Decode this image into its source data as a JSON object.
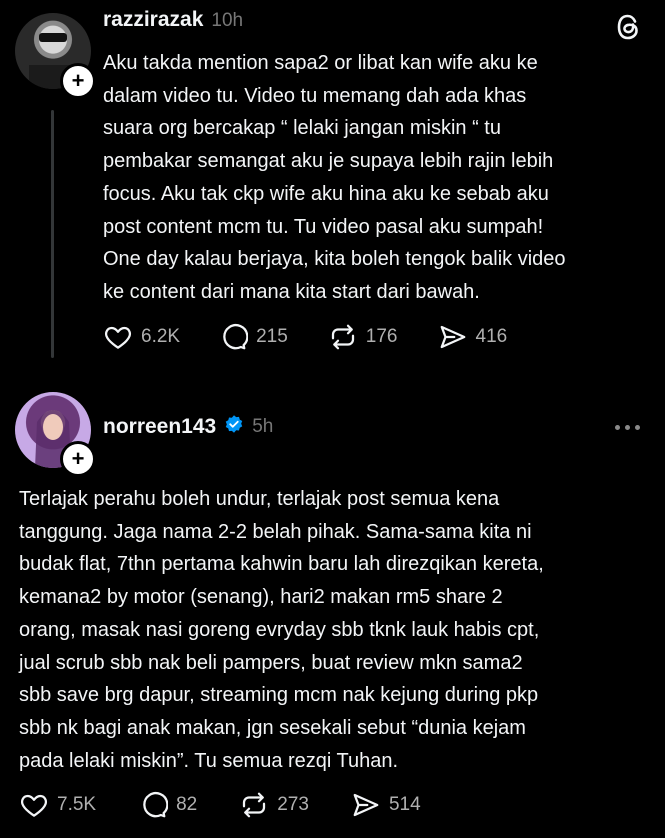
{
  "posts": [
    {
      "username": "razzirazak",
      "time": "10h",
      "verified": false,
      "text": "Aku takda mention sapa2 or libat kan wife aku ke\ndalam video tu. Video tu memang dah ada khas\nsuara org bercakap “ lelaki jangan miskin “ tu\npembakar semangat aku je supaya lebih rajin lebih\nfocus. Aku tak ckp wife aku hina aku ke sebab aku\npost content mcm tu. Tu video pasal aku sumpah!\nOne day kalau berjaya, kita boleh tengok balik video\nke content dari mana kita start dari bawah.",
      "likes": "6.2K",
      "replies": "215",
      "reposts": "176",
      "shares": "416"
    },
    {
      "username": "norreen143",
      "time": "5h",
      "verified": true,
      "text": "Terlajak perahu boleh undur, terlajak post semua kena\ntanggung. Jaga nama 2-2 belah pihak. Sama-sama kita ni\nbudak flat, 7thn pertama kahwin baru lah direzqikan kereta,\nkemana2 by motor (senang), hari2 makan rm5 share 2\norang, masak nasi goreng evryday sbb tknk lauk habis cpt,\njual scrub sbb nak beli pampers, buat review mkn sama2\nsbb save brg dapur, streaming mcm nak kejung during pkp\nsbb nk bagi anak makan, jgn sesekali sebut “dunia kejam\npada lelaki miskin”. Tu semua rezqi Tuhan.",
      "likes": "7.5K",
      "replies": "82",
      "reposts": "273",
      "shares": "514"
    }
  ],
  "plus_glyph": "+",
  "colors": {
    "background": "#000000",
    "text": "#f3f5f7",
    "muted": "#777777",
    "verified": "#0095f6"
  },
  "icons": [
    "threads-logo-icon",
    "heart-icon",
    "comment-icon",
    "repost-icon",
    "share-icon",
    "more-icon",
    "verified-icon"
  ]
}
